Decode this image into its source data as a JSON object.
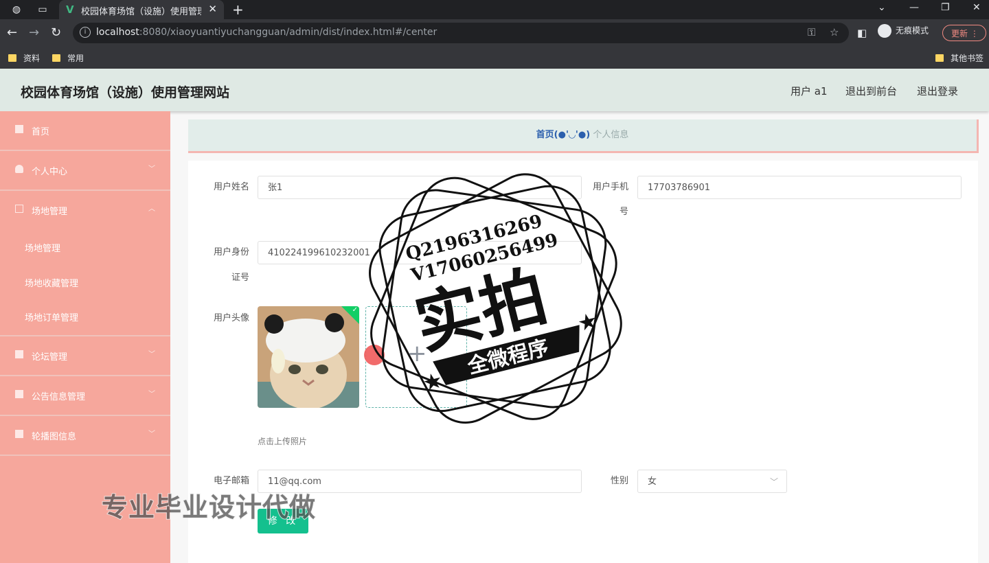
{
  "browser": {
    "tab_title": "校园体育场馆（设施）使用管理网",
    "url_host": "localhost",
    "url_rest": ":8080/xiaoyuantiyuchangguan/admin/dist/index.html#/center",
    "incognito_label": "无痕模式",
    "update_label": "更新",
    "bookmarks": [
      "资料",
      "常用"
    ],
    "other_bookmarks": "其他书签"
  },
  "header": {
    "site_title": "校园体育场馆（设施）使用管理网站",
    "user_label": "用户 a1",
    "back_to_front": "退出到前台",
    "logout": "退出登录"
  },
  "sidebar": {
    "items": [
      {
        "label": "首页"
      },
      {
        "label": "个人中心"
      },
      {
        "label": "场地管理"
      },
      {
        "label": "论坛管理"
      },
      {
        "label": "公告信息管理"
      },
      {
        "label": "轮播图信息"
      }
    ],
    "sub_items": [
      "场地管理",
      "场地收藏管理",
      "场地订单管理"
    ]
  },
  "breadcrumb": {
    "home": "首页",
    "emoji": "(●'◡'●)",
    "current": "个人信息"
  },
  "form": {
    "name_label": "用户姓名",
    "name_value": "张1",
    "phone_label_1": "用户手机",
    "phone_label_2": "号",
    "phone_value": "17703786901",
    "id_label_1": "用户身份",
    "id_label_2": "证号",
    "id_value": "410224199610232001",
    "avatar_label": "用户头像",
    "upload_hint": "点击上传照片",
    "email_label": "电子邮箱",
    "email_value": "11@qq.com",
    "gender_label": "性别",
    "gender_value": "女",
    "submit_label": "修 改"
  },
  "overlay": {
    "stamp_line1": "Q2196316269",
    "stamp_line2": "V17060256499",
    "stamp_big": "实拍",
    "stamp_banner": "全微程序",
    "watermark": "专业毕业设计代做"
  },
  "colors": {
    "sidebar_bg": "#f6a79c",
    "header_bg": "#dfe9e4",
    "button_bg": "#14c08e",
    "crumb_bg": "#e2edea"
  }
}
